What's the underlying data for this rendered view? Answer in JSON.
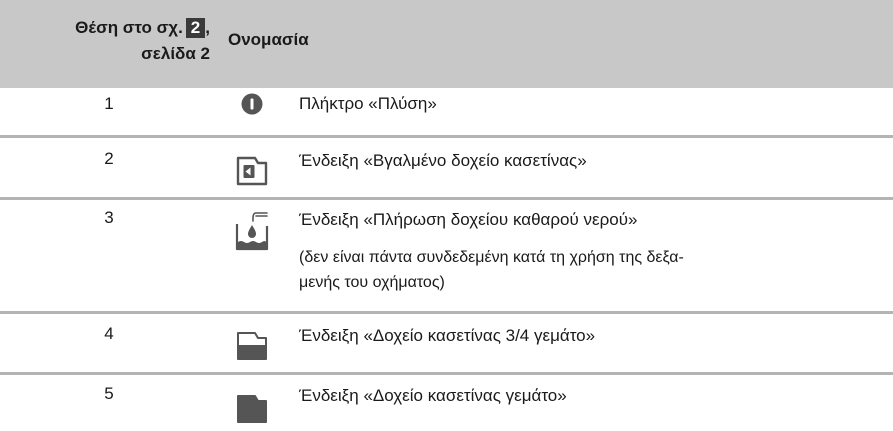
{
  "header": {
    "position_label_prefix": "Θέση στο σχ.",
    "figure_ref": "2",
    "position_label_comma": ",",
    "position_label_line2": "σελίδα 2",
    "name_label": "Ονομασία"
  },
  "rows": [
    {
      "position": "1",
      "icon": "wash-button-icon",
      "label": "Πλήκτρο «Πλύση»"
    },
    {
      "position": "2",
      "icon": "tray-removed-icon",
      "label": "Ένδειξη «Βγαλμένο δοχείο κασετίνας»"
    },
    {
      "position": "3",
      "icon": "fill-fresh-water-icon",
      "label": "Ένδειξη «Πλήρωση δοχείου καθαρού νερού»",
      "note_line1": "(δεν είναι πάντα συνδεδεμένη κατά τη χρήση της δεξα-",
      "note_line2": "μενής του οχήματος)"
    },
    {
      "position": "4",
      "icon": "tank-three-quarter-full-icon",
      "label": "Ένδειξη «Δοχείο κασετίνας 3/4 γεμάτο»"
    },
    {
      "position": "5",
      "icon": "tank-full-icon",
      "label": "Ένδειξη «Δοχείο κασετίνας γεμάτο»"
    }
  ],
  "colors": {
    "header_bg": "#c8c8c8",
    "separator": "#b4b4b4",
    "icon": "#555555"
  }
}
